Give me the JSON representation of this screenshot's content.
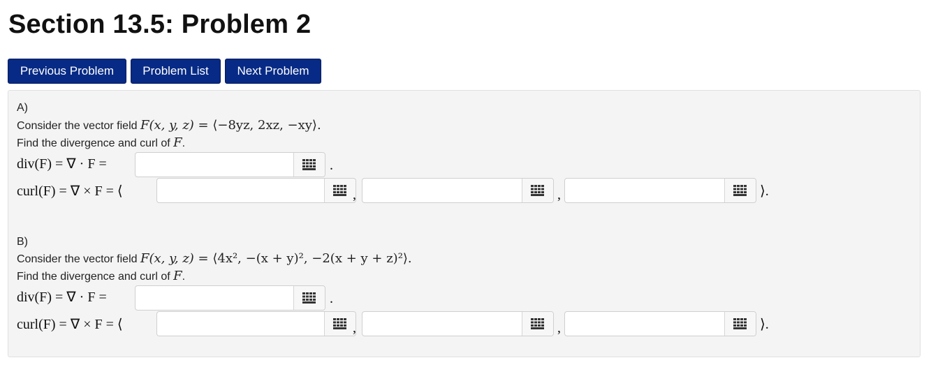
{
  "page": {
    "title": "Section 13.5: Problem 2"
  },
  "nav": {
    "prev_label": "Previous Problem",
    "list_label": "Problem List",
    "next_label": "Next Problem"
  },
  "parts": [
    {
      "label": "A)",
      "intro": "Consider the vector field ",
      "field_lhs": "F(x, y, z) = ",
      "field_rhs": "⟨−8yz, 2xz, −xy⟩.",
      "task": "Find the divergence and curl of ",
      "task_var": "F",
      "div_label": "div(F) = ∇ · F =",
      "curl_label": "curl(F) = ∇ × F = ⟨",
      "div_value": "",
      "curl_values": [
        "",
        "",
        ""
      ]
    },
    {
      "label": "B)",
      "intro": "Consider the vector field ",
      "field_lhs": "F(x, y, z) = ",
      "field_rhs": "⟨4x², −(x + y)², −2(x + y + z)²⟩.",
      "task": "Find the divergence and curl of ",
      "task_var": "F",
      "div_label": "div(F) = ∇ · F =",
      "curl_label": "curl(F) = ∇ × F = ⟨",
      "div_value": "",
      "curl_values": [
        "",
        "",
        ""
      ]
    }
  ],
  "punct": {
    "period": ".",
    "comma": ",",
    "close": "⟩."
  },
  "icons": {
    "equation_editor": "grid-keypad-icon"
  }
}
